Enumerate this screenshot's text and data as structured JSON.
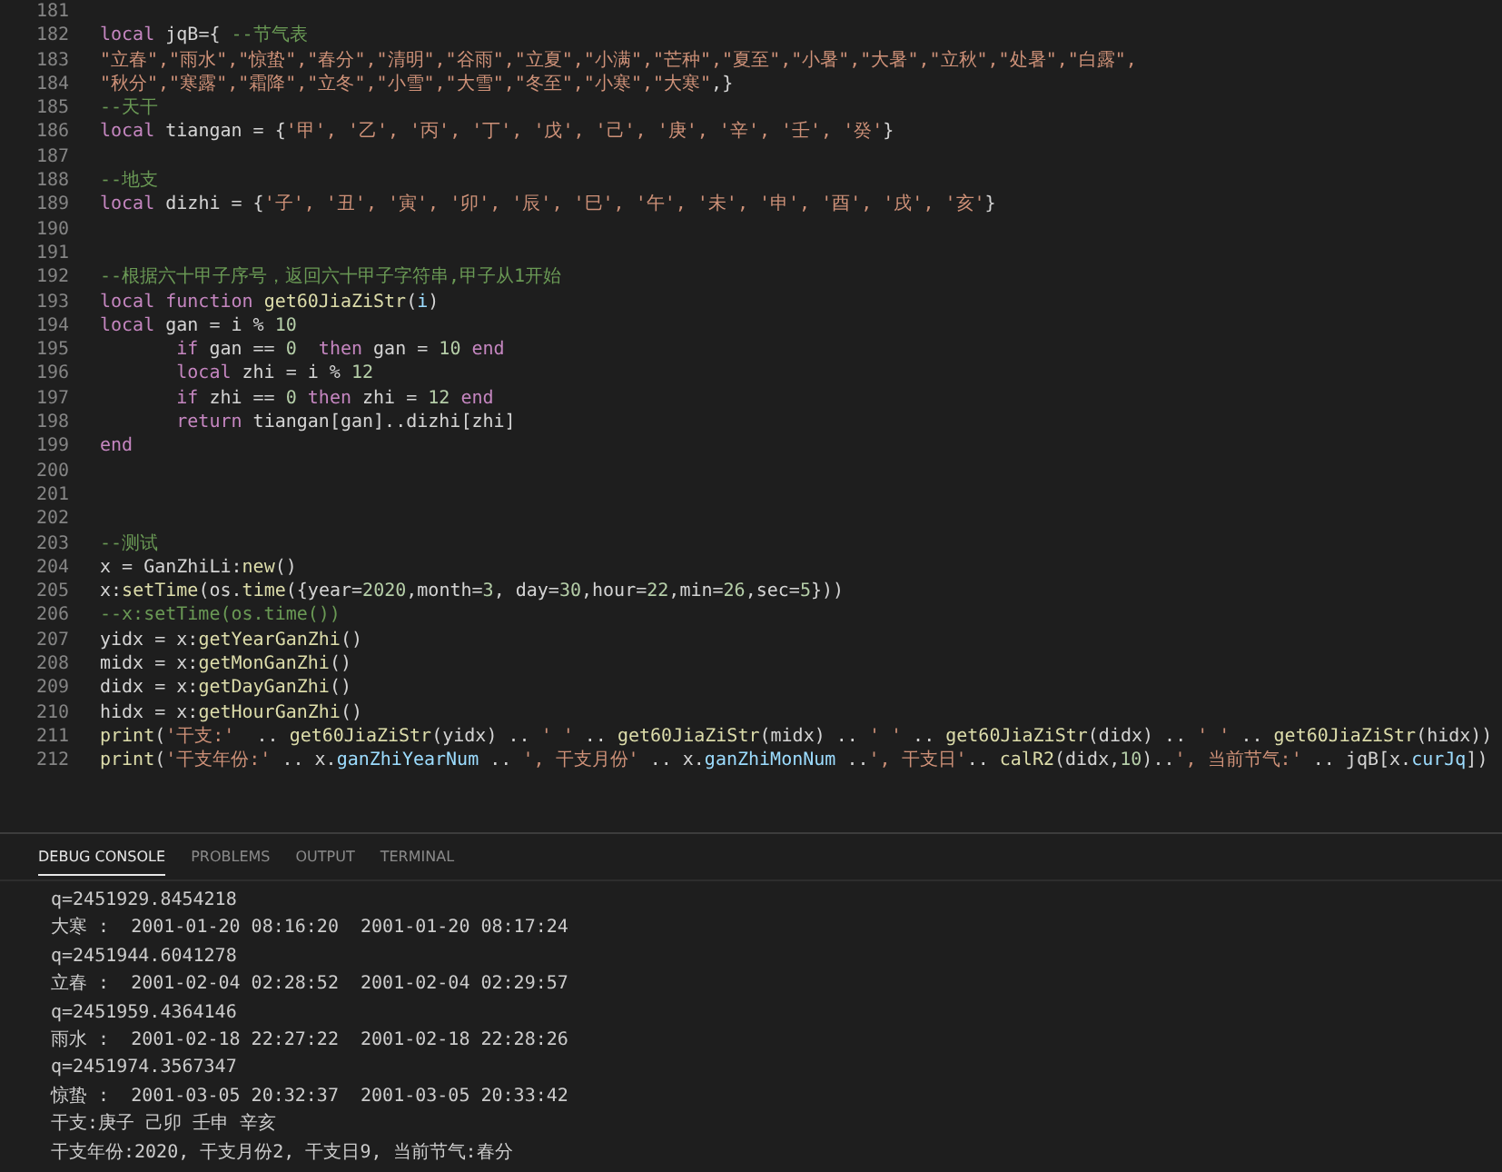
{
  "editor": {
    "lines": [
      {
        "number": "181"
      },
      {
        "number": "182",
        "tokens": [
          {
            "kind": "keyword",
            "text": "local"
          },
          {
            "kind": "plain",
            "text": " jqB={ "
          },
          {
            "kind": "comment",
            "text": "--节气表"
          }
        ]
      },
      {
        "number": "183",
        "tokens": [
          {
            "kind": "string",
            "text": "\"立春\",\"雨水\",\"惊蛰\",\"春分\",\"清明\",\"谷雨\",\"立夏\",\"小满\",\"芒种\",\"夏至\",\"小暑\",\"大暑\",\"立秋\",\"处暑\",\"白露\","
          }
        ]
      },
      {
        "number": "184",
        "tokens": [
          {
            "kind": "string",
            "text": "\"秋分\",\"寒露\",\"霜降\",\"立冬\",\"小雪\",\"大雪\",\"冬至\",\"小寒\",\"大寒\""
          },
          {
            "kind": "plain",
            "text": ",}"
          }
        ]
      },
      {
        "number": "185",
        "tokens": [
          {
            "kind": "comment",
            "text": "--天干"
          }
        ]
      },
      {
        "number": "186",
        "tokens": [
          {
            "kind": "keyword",
            "text": "local"
          },
          {
            "kind": "plain",
            "text": " tiangan = {"
          },
          {
            "kind": "string",
            "text": "'甲', '乙', '丙', '丁', '戊', '己', '庚', '辛', '壬', '癸'"
          },
          {
            "kind": "plain",
            "text": "}"
          }
        ]
      },
      {
        "number": "187"
      },
      {
        "number": "188",
        "tokens": [
          {
            "kind": "comment",
            "text": "--地支"
          }
        ]
      },
      {
        "number": "189",
        "tokens": [
          {
            "kind": "keyword",
            "text": "local"
          },
          {
            "kind": "plain",
            "text": " dizhi = {"
          },
          {
            "kind": "string",
            "text": "'子', '丑', '寅', '卯', '辰', '巳', '午', '未', '申', '酉', '戌', '亥'"
          },
          {
            "kind": "plain",
            "text": "}"
          }
        ]
      },
      {
        "number": "190"
      },
      {
        "number": "191"
      },
      {
        "number": "192",
        "tokens": [
          {
            "kind": "comment",
            "text": "--根据六十甲子序号，返回六十甲子字符串,甲子从1开始"
          }
        ]
      },
      {
        "number": "193",
        "tokens": [
          {
            "kind": "keyword",
            "text": "local function "
          },
          {
            "kind": "function",
            "text": "get60JiaZiStr"
          },
          {
            "kind": "plain",
            "text": "("
          },
          {
            "kind": "variable",
            "text": "i"
          },
          {
            "kind": "plain",
            "text": ")"
          }
        ]
      },
      {
        "number": "194",
        "tokens": [
          {
            "kind": "keyword",
            "text": "local"
          },
          {
            "kind": "plain",
            "text": " gan = i % "
          },
          {
            "kind": "number",
            "text": "10"
          }
        ]
      },
      {
        "number": "195",
        "tokens": [
          {
            "kind": "keyword",
            "text": "       if"
          },
          {
            "kind": "plain",
            "text": " gan == "
          },
          {
            "kind": "number",
            "text": "0"
          },
          {
            "kind": "keyword",
            "text": "  then"
          },
          {
            "kind": "plain",
            "text": " gan = "
          },
          {
            "kind": "number",
            "text": "10"
          },
          {
            "kind": "keyword",
            "text": " end"
          }
        ]
      },
      {
        "number": "196",
        "tokens": [
          {
            "kind": "keyword",
            "text": "       local"
          },
          {
            "kind": "plain",
            "text": " zhi = i % "
          },
          {
            "kind": "number",
            "text": "12"
          }
        ]
      },
      {
        "number": "197",
        "tokens": [
          {
            "kind": "keyword",
            "text": "       if"
          },
          {
            "kind": "plain",
            "text": " zhi == "
          },
          {
            "kind": "number",
            "text": "0"
          },
          {
            "kind": "keyword",
            "text": " then"
          },
          {
            "kind": "plain",
            "text": " zhi = "
          },
          {
            "kind": "number",
            "text": "12"
          },
          {
            "kind": "keyword",
            "text": " end"
          }
        ]
      },
      {
        "number": "198",
        "tokens": [
          {
            "kind": "keyword",
            "text": "       return"
          },
          {
            "kind": "plain",
            "text": " tiangan[gan]..dizhi[zhi]"
          }
        ]
      },
      {
        "number": "199",
        "tokens": [
          {
            "kind": "keyword",
            "text": "end"
          }
        ]
      },
      {
        "number": "200"
      },
      {
        "number": "201"
      },
      {
        "number": "202"
      },
      {
        "number": "203",
        "tokens": [
          {
            "kind": "comment",
            "text": "--测试"
          }
        ]
      },
      {
        "number": "204",
        "tokens": [
          {
            "kind": "plain",
            "text": "x = GanZhiLi:"
          },
          {
            "kind": "function",
            "text": "new"
          },
          {
            "kind": "plain",
            "text": "()"
          }
        ]
      },
      {
        "number": "205",
        "tokens": [
          {
            "kind": "plain",
            "text": "x:"
          },
          {
            "kind": "function",
            "text": "setTime"
          },
          {
            "kind": "plain",
            "text": "(os."
          },
          {
            "kind": "function",
            "text": "time"
          },
          {
            "kind": "plain",
            "text": "({year="
          },
          {
            "kind": "number",
            "text": "2020"
          },
          {
            "kind": "plain",
            "text": ",month="
          },
          {
            "kind": "number",
            "text": "3"
          },
          {
            "kind": "plain",
            "text": ", day="
          },
          {
            "kind": "number",
            "text": "30"
          },
          {
            "kind": "plain",
            "text": ",hour="
          },
          {
            "kind": "number",
            "text": "22"
          },
          {
            "kind": "plain",
            "text": ",min="
          },
          {
            "kind": "number",
            "text": "26"
          },
          {
            "kind": "plain",
            "text": ",sec="
          },
          {
            "kind": "number",
            "text": "5"
          },
          {
            "kind": "plain",
            "text": "}))"
          }
        ]
      },
      {
        "number": "206",
        "tokens": [
          {
            "kind": "comment",
            "text": "--x:setTime(os.time())"
          }
        ]
      },
      {
        "number": "207",
        "tokens": [
          {
            "kind": "plain",
            "text": "yidx = x:"
          },
          {
            "kind": "function",
            "text": "getYearGanZhi"
          },
          {
            "kind": "plain",
            "text": "()"
          }
        ]
      },
      {
        "number": "208",
        "tokens": [
          {
            "kind": "plain",
            "text": "midx = x:"
          },
          {
            "kind": "function",
            "text": "getMonGanZhi"
          },
          {
            "kind": "plain",
            "text": "()"
          }
        ]
      },
      {
        "number": "209",
        "tokens": [
          {
            "kind": "plain",
            "text": "didx = x:"
          },
          {
            "kind": "function",
            "text": "getDayGanZhi"
          },
          {
            "kind": "plain",
            "text": "()"
          }
        ]
      },
      {
        "number": "210",
        "tokens": [
          {
            "kind": "plain",
            "text": "hidx = x:"
          },
          {
            "kind": "function",
            "text": "getHourGanZhi"
          },
          {
            "kind": "plain",
            "text": "()"
          }
        ]
      },
      {
        "number": "211",
        "tokens": [
          {
            "kind": "function",
            "text": "print"
          },
          {
            "kind": "plain",
            "text": "("
          },
          {
            "kind": "string",
            "text": "'干支:'"
          },
          {
            "kind": "plain",
            "text": "  .. "
          },
          {
            "kind": "function",
            "text": "get60JiaZiStr"
          },
          {
            "kind": "plain",
            "text": "(yidx) .. "
          },
          {
            "kind": "string",
            "text": "' '"
          },
          {
            "kind": "plain",
            "text": " .. "
          },
          {
            "kind": "function",
            "text": "get60JiaZiStr"
          },
          {
            "kind": "plain",
            "text": "(midx) .. "
          },
          {
            "kind": "string",
            "text": "' '"
          },
          {
            "kind": "plain",
            "text": " .. "
          },
          {
            "kind": "function",
            "text": "get60JiaZiStr"
          },
          {
            "kind": "plain",
            "text": "(didx) .. "
          },
          {
            "kind": "string",
            "text": "' '"
          },
          {
            "kind": "plain",
            "text": " .. "
          },
          {
            "kind": "function",
            "text": "get60JiaZiStr"
          },
          {
            "kind": "plain",
            "text": "(hidx))"
          }
        ]
      },
      {
        "number": "212",
        "tokens": [
          {
            "kind": "function",
            "text": "print"
          },
          {
            "kind": "plain",
            "text": "("
          },
          {
            "kind": "string",
            "text": "'干支年份:'"
          },
          {
            "kind": "plain",
            "text": " .. x."
          },
          {
            "kind": "variable",
            "text": "ganZhiYearNum"
          },
          {
            "kind": "plain",
            "text": " .. "
          },
          {
            "kind": "string",
            "text": "', 干支月份'"
          },
          {
            "kind": "plain",
            "text": " .. x."
          },
          {
            "kind": "variable",
            "text": "ganZhiMonNum"
          },
          {
            "kind": "plain",
            "text": " .."
          },
          {
            "kind": "string",
            "text": "', 干支日'"
          },
          {
            "kind": "plain",
            "text": ".. "
          },
          {
            "kind": "function",
            "text": "calR2"
          },
          {
            "kind": "plain",
            "text": "(didx,"
          },
          {
            "kind": "number",
            "text": "10"
          },
          {
            "kind": "plain",
            "text": ").."
          },
          {
            "kind": "string",
            "text": "', 当前节气:'"
          },
          {
            "kind": "plain",
            "text": " .. jqB[x."
          },
          {
            "kind": "variable",
            "text": "curJq"
          },
          {
            "kind": "plain",
            "text": "])"
          }
        ]
      }
    ]
  },
  "panel": {
    "tabs": [
      {
        "label": "DEBUG CONSOLE",
        "selected": true
      },
      {
        "label": "PROBLEMS",
        "selected": false
      },
      {
        "label": "OUTPUT",
        "selected": false
      },
      {
        "label": "TERMINAL",
        "selected": false
      }
    ],
    "console_lines": [
      "q=2451929.8454218",
      "大寒 :  2001-01-20 08:16:20  2001-01-20 08:17:24",
      "q=2451944.6041278",
      "立春 :  2001-02-04 02:28:52  2001-02-04 02:29:57",
      "q=2451959.4364146",
      "雨水 :  2001-02-18 22:27:22  2001-02-18 22:28:26",
      "q=2451974.3567347",
      "惊蛰 :  2001-03-05 20:32:37  2001-03-05 20:33:42",
      "干支:庚子 己卯 壬申 辛亥",
      "干支年份:2020, 干支月份2, 干支日9, 当前节气:春分"
    ]
  }
}
